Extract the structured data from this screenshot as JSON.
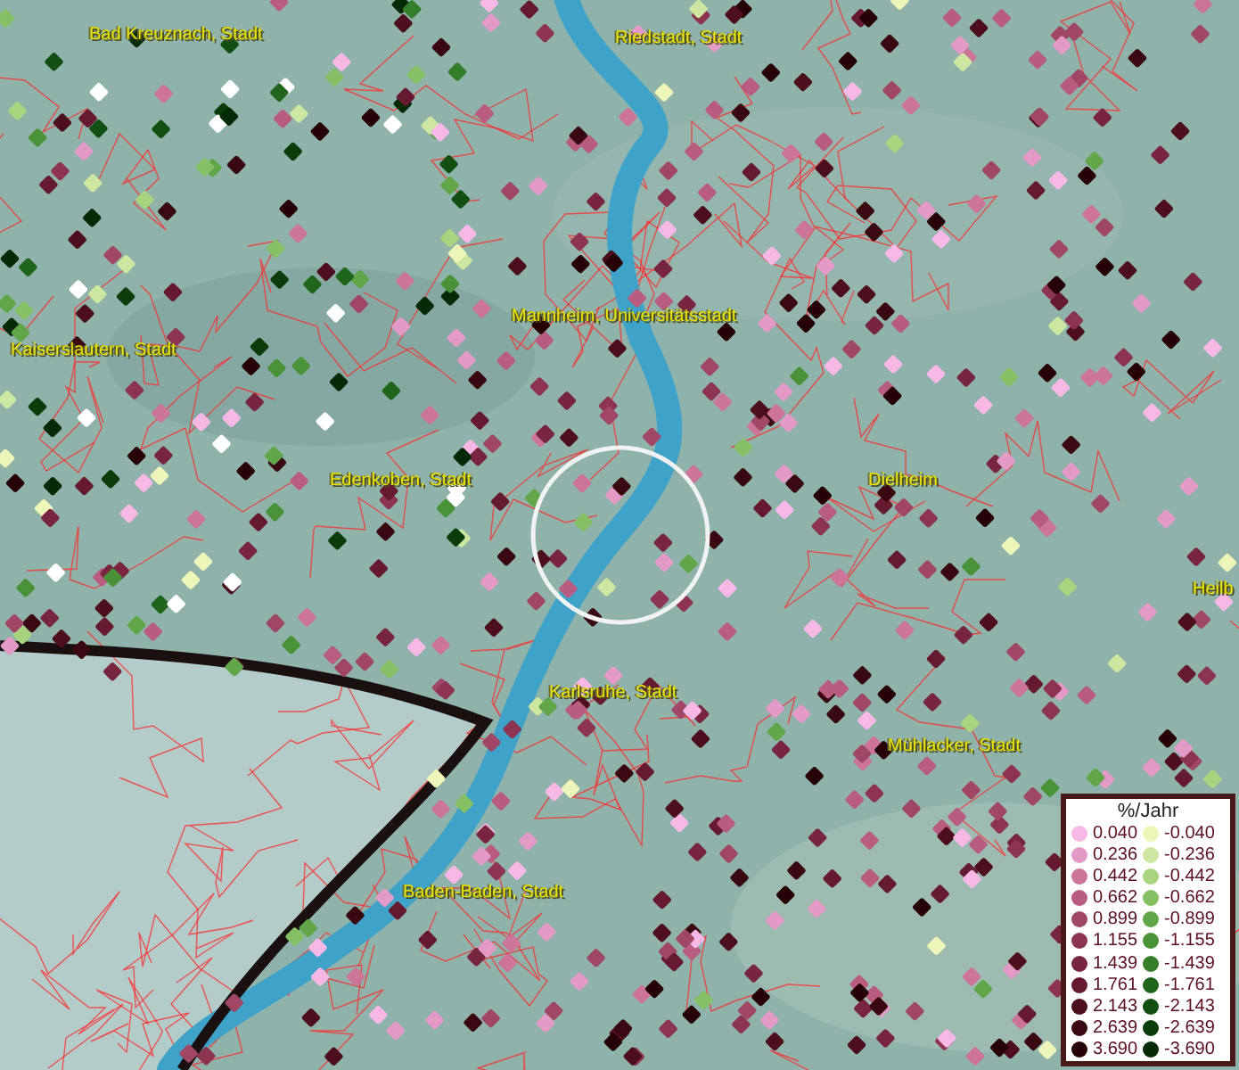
{
  "map": {
    "places": [
      {
        "name": "Bad Kreuznach, Stadt"
      },
      {
        "name": "Riedstadt, Stadt"
      },
      {
        "name": "Mannheim, Universitätsstadt"
      },
      {
        "name": "Kaiserslautern, Stadt"
      },
      {
        "name": "Edenkoben, Stadt"
      },
      {
        "name": "Dielheim"
      },
      {
        "name": "Heilb"
      },
      {
        "name": "Karlsruhe, Stadt"
      },
      {
        "name": "Mühlacker, Stadt"
      },
      {
        "name": "Baden-Baden, Stadt"
      }
    ]
  },
  "legend": {
    "title": "%/Jahr",
    "positive": [
      {
        "label": "0.040",
        "color": "#f7b8e6"
      },
      {
        "label": "0.236",
        "color": "#e49ac6"
      },
      {
        "label": "0.442",
        "color": "#cc7599"
      },
      {
        "label": "0.662",
        "color": "#b85c80"
      },
      {
        "label": "0.899",
        "color": "#a04766"
      },
      {
        "label": "1.155",
        "color": "#8c3450"
      },
      {
        "label": "1.439",
        "color": "#782640"
      },
      {
        "label": "1.761",
        "color": "#661a30"
      },
      {
        "label": "2.143",
        "color": "#4d0f1e"
      },
      {
        "label": "2.639",
        "color": "#3a0812"
      },
      {
        "label": "3.690",
        "color": "#260208"
      }
    ],
    "negative": [
      {
        "label": "-0.040",
        "color": "#eef5b8"
      },
      {
        "label": "-0.236",
        "color": "#cde6a0"
      },
      {
        "label": "-0.442",
        "color": "#a8d47f"
      },
      {
        "label": "-0.662",
        "color": "#86c064"
      },
      {
        "label": "-0.899",
        "color": "#62a64a"
      },
      {
        "label": "-1.155",
        "color": "#4a9238"
      },
      {
        "label": "-1.439",
        "color": "#347e2a"
      },
      {
        "label": "-1.761",
        "color": "#1f661c"
      },
      {
        "label": "-2.143",
        "color": "#124f12"
      },
      {
        "label": "-2.639",
        "color": "#0a3d0a"
      },
      {
        "label": "-3.690",
        "color": "#052b06"
      }
    ]
  }
}
